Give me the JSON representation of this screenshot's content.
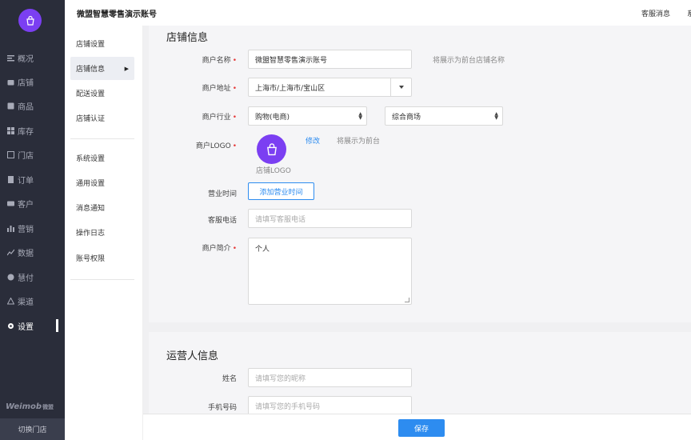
{
  "header": {
    "title": "微盟智慧零售演示账号",
    "service_message": "客服消息",
    "system_cut": "系"
  },
  "nav": {
    "brand": "Weimob",
    "brand_cn": "微盟",
    "switch_store": "切换门店",
    "items": [
      {
        "label": "概况",
        "icon": "overview-icon"
      },
      {
        "label": "店铺",
        "icon": "store-icon"
      },
      {
        "label": "商品",
        "icon": "goods-icon"
      },
      {
        "label": "库存",
        "icon": "inventory-icon"
      },
      {
        "label": "门店",
        "icon": "shop-icon"
      },
      {
        "label": "订单",
        "icon": "order-icon"
      },
      {
        "label": "客户",
        "icon": "customer-icon"
      },
      {
        "label": "营销",
        "icon": "marketing-icon"
      },
      {
        "label": "数据",
        "icon": "data-icon"
      },
      {
        "label": "慧付",
        "icon": "pay-icon"
      },
      {
        "label": "渠道",
        "icon": "channel-icon"
      },
      {
        "label": "设置",
        "icon": "settings-icon"
      }
    ]
  },
  "submenu": {
    "store_group": "店铺设置",
    "store_info": "店铺信息",
    "delivery": "配送设置",
    "certification": "店铺认证",
    "system_group": "系统设置",
    "general": "通用设置",
    "notification": "消息通知",
    "logs": "操作日志",
    "permissions": "账号权限"
  },
  "store_info": {
    "title": "店铺信息",
    "merchant_name_label": "商户名称",
    "merchant_name_value": "微盟智慧零售演示账号",
    "merchant_name_hint": "将展示为前台店铺名称",
    "address_label": "商户地址",
    "address_value": "上海市/上海市/宝山区",
    "industry_label": "商户行业",
    "industry_primary": "购物(电商)",
    "industry_secondary": "综合商场",
    "logo_label": "商户LOGO",
    "logo_caption": "店铺LOGO",
    "logo_edit": "修改",
    "logo_hint": "将展示为前台",
    "hours_label": "营业时间",
    "hours_button": "添加营业时间",
    "phone_label": "客服电话",
    "phone_placeholder": "请填写客服电话",
    "intro_label": "商户简介",
    "intro_value": "个人"
  },
  "operator_info": {
    "title": "运营人信息",
    "name_label": "姓名",
    "name_placeholder": "请填写您的昵称",
    "mobile_label": "手机号码",
    "mobile_placeholder": "请填写您的手机号码"
  },
  "actions": {
    "save": "保存"
  },
  "colors": {
    "brand_purple": "#7b3ff2",
    "primary_blue": "#2d8cf0",
    "sidebar_dark": "#2a2d3a",
    "required_red": "#e63b3b"
  }
}
